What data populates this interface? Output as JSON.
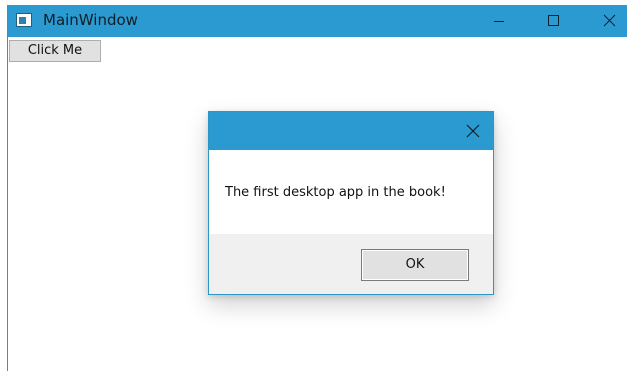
{
  "window": {
    "title": "MainWindow",
    "controls": {
      "minimize_icon": "minimize-icon",
      "maximize_icon": "maximize-icon",
      "close_icon": "close-icon"
    }
  },
  "main": {
    "button_label": "Click Me"
  },
  "dialog": {
    "message": "The first desktop app in the book!",
    "ok_label": "OK",
    "close_icon": "close-icon"
  },
  "colors": {
    "titlebar": "#2b9ad1",
    "dialog_footer": "#f0f0f0",
    "button_face": "#e1e1e1"
  }
}
